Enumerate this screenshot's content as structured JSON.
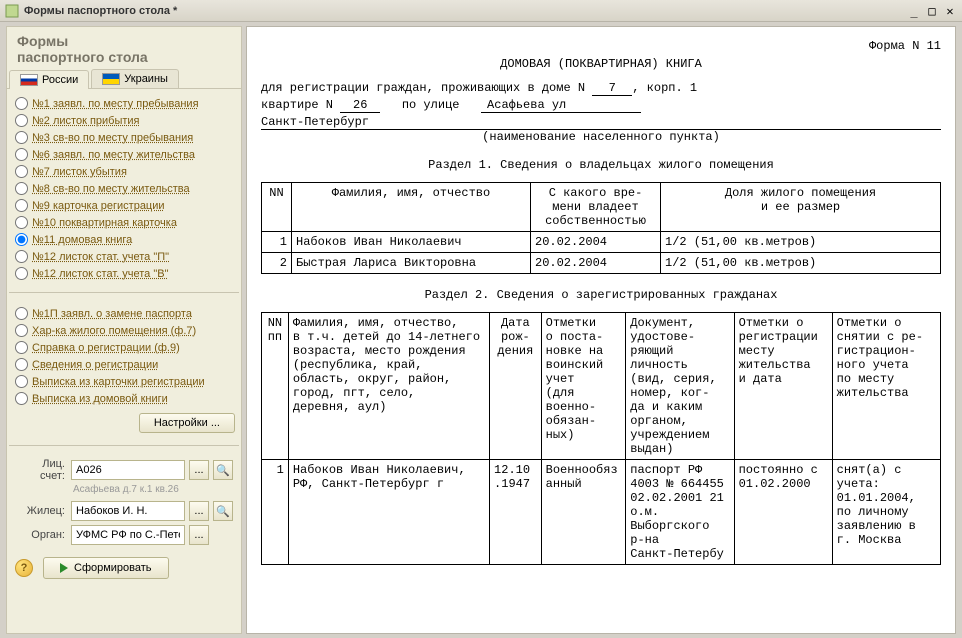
{
  "window": {
    "title": "Формы паспортного стола *"
  },
  "sidebar": {
    "header_l1": "Формы",
    "header_l2": "паспортного стола",
    "tabs": {
      "ru": "России",
      "ua": "Украины"
    },
    "group1": [
      {
        "id": "f1",
        "label": "№1  заявл. по месту пребывания"
      },
      {
        "id": "f2",
        "label": "№2  листок прибытия"
      },
      {
        "id": "f3",
        "label": "№3  св-во по месту пребывания"
      },
      {
        "id": "f6",
        "label": "№6  заявл. по месту жительства"
      },
      {
        "id": "f7",
        "label": "№7  листок убытия"
      },
      {
        "id": "f8",
        "label": "№8  св-во по месту жительства"
      },
      {
        "id": "f9",
        "label": "№9  карточка регистрации"
      },
      {
        "id": "f10",
        "label": "№10 поквартирная карточка"
      },
      {
        "id": "f11",
        "label": "№11 домовая книга"
      },
      {
        "id": "f12",
        "label": "№12 листок стат. учета \"П\""
      },
      {
        "id": "f12b",
        "label": "№12 листок стат. учета \"В\""
      }
    ],
    "selected1": "f11",
    "group2": [
      {
        "id": "g1",
        "label": "№1П  заявл. о замене паспорта"
      },
      {
        "id": "g2",
        "label": "Хар-ка жилого помещения (ф.7)"
      },
      {
        "id": "g3",
        "label": "Справка о регистрации (ф.9)"
      },
      {
        "id": "g4",
        "label": "Сведения о регистрации"
      },
      {
        "id": "g5",
        "label": "Выписка из карточки регистрации"
      },
      {
        "id": "g6",
        "label": "Выписка из домовой книги"
      }
    ],
    "settings_btn": "Настройки ...",
    "fields": {
      "account_label": "Лиц. счет:",
      "account_value": "А026",
      "account_hint": "Асафьева д.7 к.1 кв.26",
      "resident_label": "Жилец:",
      "resident_value": "Набоков И. Н.",
      "organ_label": "Орган:",
      "organ_value": "УФМС РФ по С.-Пете"
    },
    "generate_btn": "Сформировать"
  },
  "document": {
    "form_no": "Форма N  11",
    "title": "ДОМОВАЯ (ПОКВАРТИРНАЯ) КНИГА",
    "reg_text_prefix": "для регистрации граждан, проживающих в доме N",
    "house_no": "7",
    "korp_label": ", корп.",
    "korp_no": "1",
    "flat_label": "квартире  N",
    "flat_no": "26",
    "street_label": "по улице",
    "street": "Асафьева ул",
    "city": "Санкт-Петербург",
    "city_hint": "(наименование населенного пункта)",
    "section1_title": "Раздел 1. Сведения о владельцах жилого помещения",
    "t1_headers": {
      "nn": "NN",
      "fio": "Фамилия, имя, отчество",
      "since": "С какого  вре-\nмени  владеет\nсобственностью",
      "share": "Доля жилого помещения\nи ее размер"
    },
    "t1_rows": [
      {
        "n": "1",
        "fio": "Набоков Иван Николаевич",
        "date": "20.02.2004",
        "share": "1/2  (51,00 кв.метров)"
      },
      {
        "n": "2",
        "fio": "Быстрая Лариса Викторовна",
        "date": "20.02.2004",
        "share": "1/2  (51,00 кв.метров)"
      }
    ],
    "section2_title": "Раздел 2. Сведения о зарегистрированных гражданах",
    "t2_headers": {
      "nn": "NN\nпп",
      "fio": "Фамилия, имя, отчество,\nв т.ч. детей до 14-летнего\nвозраста, место рождения\n(республика, край,\nобласть, округ, район,\nгород, пгт, село,\nдеревня, аул)",
      "birth": "Дата\nрож-\nдения",
      "mil": "Отметки\nо поста-\nновке на\nвоинский\nучет\n(для\nвоенно-\nобязан-\nных)",
      "docv": "Документ,\nудостове-\nряющий\nличность\n(вид, серия,\nномер, ког-\nда и каким\nорганом,\nучреждением\nвыдан)",
      "reg": "Отметки о\nрегистрации\nместу\nжительства\nи дата",
      "dereg": "Отметки о\nснятии с ре-\nгистрацион-\nного учета\nпо месту\nжительства"
    },
    "t2_rows": [
      {
        "n": "1",
        "fio": "Набоков Иван Николаевич,\nРФ, Санкт-Петербург г",
        "birth": "12.10\n.1947",
        "mil": "Военнообяз\nанный",
        "docv": "паспорт РФ\n4003 № 664455\n02.02.2001 21\nо.м.\nВыборгского\nр-на\nСанкт-Петербу",
        "reg": "постоянно с\n01.02.2000",
        "dereg": "снят(а) с\nучета:\n01.01.2004,\nпо личному\nзаявлению в\nг. Москва"
      }
    ]
  }
}
